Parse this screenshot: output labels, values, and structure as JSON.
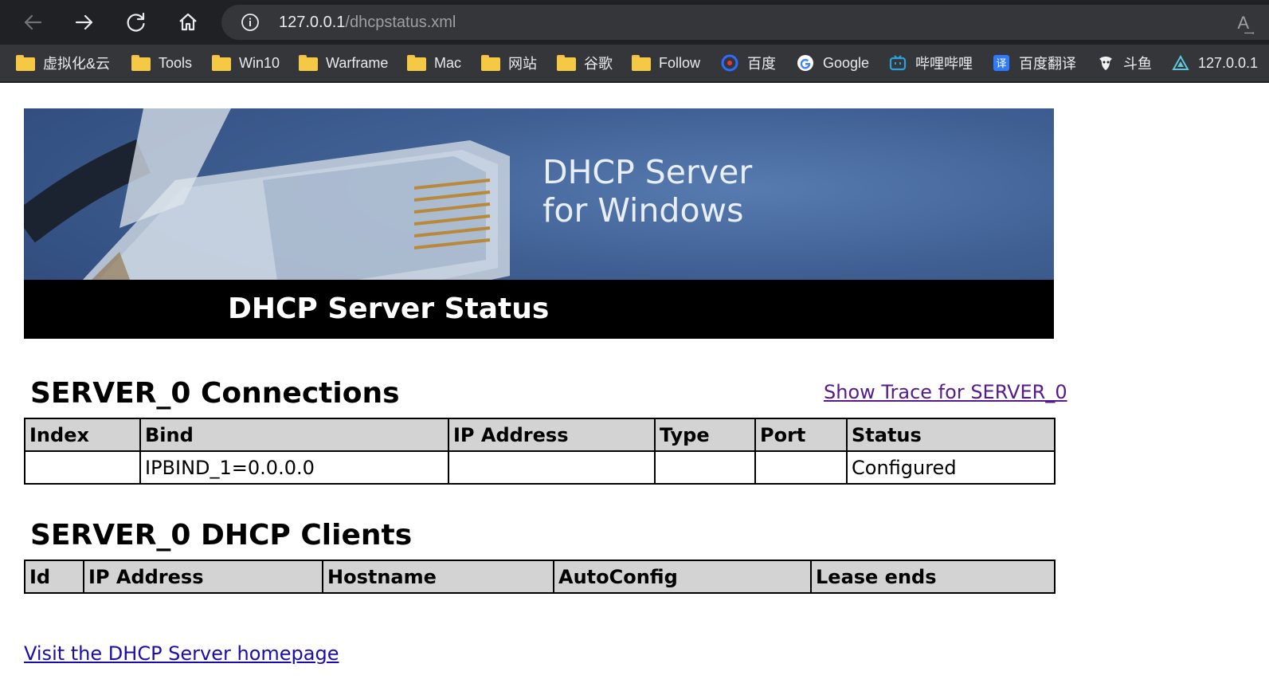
{
  "browser": {
    "url_host": "127.0.0.1",
    "url_path": "/dhcpstatus.xml",
    "read_aloud_glyph": "A͢",
    "bookmarks": [
      {
        "label": "虚拟化&云",
        "icon": "folder-icon"
      },
      {
        "label": "Tools",
        "icon": "folder-icon"
      },
      {
        "label": "Win10",
        "icon": "folder-icon"
      },
      {
        "label": "Warframe",
        "icon": "folder-icon"
      },
      {
        "label": "Mac",
        "icon": "folder-icon"
      },
      {
        "label": "网站",
        "icon": "folder-icon"
      },
      {
        "label": "谷歌",
        "icon": "folder-icon"
      },
      {
        "label": "Follow",
        "icon": "folder-icon"
      },
      {
        "label": "百度",
        "icon": "baidu-icon"
      },
      {
        "label": "Google",
        "icon": "google-icon"
      },
      {
        "label": "哔哩哔哩",
        "icon": "bilibili-icon"
      },
      {
        "label": "百度翻译",
        "icon": "translate-icon"
      },
      {
        "label": "斗鱼",
        "icon": "douyu-icon"
      },
      {
        "label": "127.0.0.1",
        "icon": "triangle-icon"
      }
    ]
  },
  "banner": {
    "title_line1": "DHCP Server",
    "title_line2": "for Windows",
    "subtitle": "DHCP Server Status"
  },
  "connections": {
    "title": "SERVER_0 Connections",
    "trace_link": "Show Trace for SERVER_0",
    "headers": [
      "Index",
      "Bind",
      "IP Address",
      "Type",
      "Port",
      "Status"
    ],
    "rows": [
      [
        "",
        "IPBIND_1=0.0.0.0",
        "",
        "",
        "",
        "Configured"
      ]
    ]
  },
  "clients": {
    "title": "SERVER_0 DHCP Clients",
    "headers": [
      "Id",
      "IP Address",
      "Hostname",
      "AutoConfig",
      "Lease ends"
    ],
    "rows": []
  },
  "footer": {
    "homepage_link": "Visit the DHCP Server homepage"
  },
  "colors": {
    "chrome_dark": "#202124",
    "chrome_bar": "#35363a",
    "header_cell": "#d3d3d3",
    "visited_link": "#551a8b",
    "link": "#1a0dab"
  }
}
